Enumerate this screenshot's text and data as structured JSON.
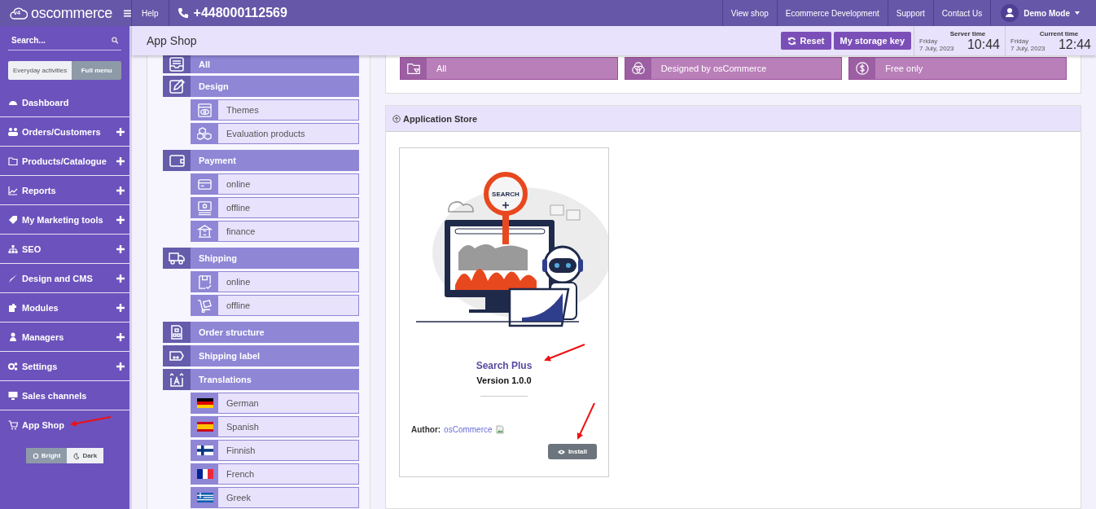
{
  "topbar": {
    "logo_badge": "v4",
    "logo": "oscommerce",
    "help": "Help",
    "phone": "+448000112569",
    "links": [
      "View shop",
      "Ecommerce Development",
      "Support",
      "Contact Us"
    ],
    "user": "Demo Mode"
  },
  "sidebar": {
    "search_placeholder": "Search...",
    "menu_toggle": [
      {
        "label": "Everyday activities",
        "selected": false
      },
      {
        "label": "Full menu",
        "selected": true
      }
    ],
    "items": [
      {
        "label": "Dashboard",
        "expandable": false
      },
      {
        "label": "Orders/Customers",
        "expandable": true
      },
      {
        "label": "Products/Catalogue",
        "expandable": true
      },
      {
        "label": "Reports",
        "expandable": true
      },
      {
        "label": "My Marketing tools",
        "expandable": true
      },
      {
        "label": "SEO",
        "expandable": true
      },
      {
        "label": "Design and CMS",
        "expandable": true
      },
      {
        "label": "Modules",
        "expandable": true
      },
      {
        "label": "Managers",
        "expandable": true
      },
      {
        "label": "Settings",
        "expandable": true
      },
      {
        "label": "Sales channels",
        "expandable": false
      },
      {
        "label": "App Shop",
        "expandable": false
      }
    ],
    "theme_toggle": [
      {
        "label": "Bright",
        "selected": true
      },
      {
        "label": "Dark",
        "selected": false
      }
    ]
  },
  "header": {
    "title": "App Shop",
    "buttons": [
      {
        "label": "Reset",
        "kind": "reset"
      },
      {
        "label": "My storage key",
        "kind": "plain"
      }
    ],
    "clocks": [
      {
        "label": "Server time",
        "day": "Friday",
        "date": "7 July, 2023",
        "time": "10:44"
      },
      {
        "label": "Current time",
        "day": "Friday",
        "date": "7 July, 2023",
        "time": "12:44"
      }
    ]
  },
  "categories": [
    {
      "label": "All"
    },
    {
      "label": "Design",
      "children": [
        {
          "label": "Themes"
        },
        {
          "label": "Evaluation products"
        }
      ]
    },
    {
      "label": "Payment",
      "children": [
        {
          "label": "online"
        },
        {
          "label": "offline"
        },
        {
          "label": "finance"
        }
      ]
    },
    {
      "label": "Shipping",
      "children": [
        {
          "label": "online"
        },
        {
          "label": "offline"
        }
      ]
    },
    {
      "label": "Order structure"
    },
    {
      "label": "Shipping label"
    },
    {
      "label": "Translations",
      "children": [
        {
          "label": "German"
        },
        {
          "label": "Spanish"
        },
        {
          "label": "Finnish"
        },
        {
          "label": "French"
        },
        {
          "label": "Greek"
        }
      ]
    }
  ],
  "filters": [
    {
      "label": "All"
    },
    {
      "label": "Designed by osCommerce"
    },
    {
      "label": "Free only"
    }
  ],
  "store": {
    "title": "Application Store",
    "apps": [
      {
        "illustration_label": "SEARCH",
        "name": "Search Plus",
        "version": "Version 1.0.0",
        "author_label": "Author:",
        "author": "osCommerce",
        "button": "Install"
      }
    ]
  }
}
